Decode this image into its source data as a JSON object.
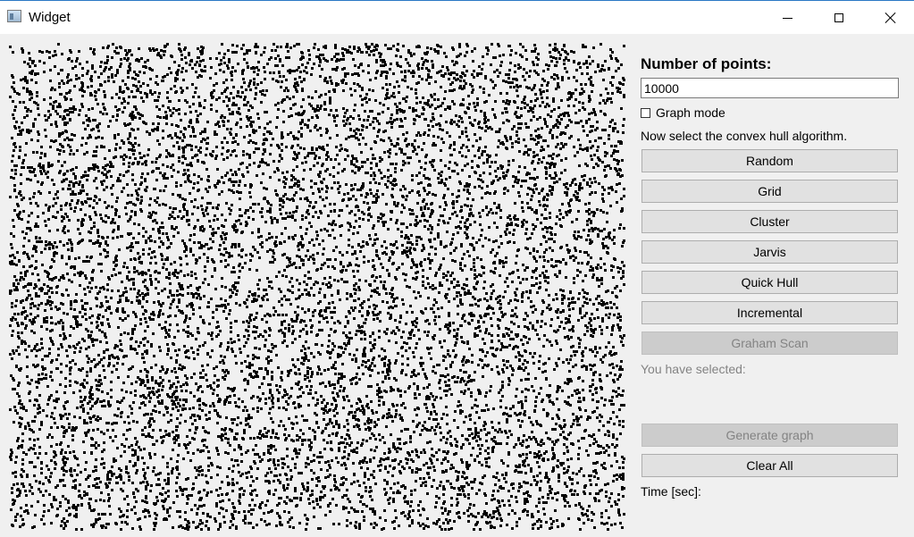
{
  "window": {
    "title": "Widget"
  },
  "canvas": {
    "point_count": 10000,
    "point_color": "#000000",
    "background": "#f0f0f0"
  },
  "panel": {
    "heading": "Number of points:",
    "points_value": "10000",
    "graph_mode_label": "Graph mode",
    "graph_mode_checked": false,
    "instruction": "Now select the convex hull algorithm.",
    "buttons": {
      "random": "Random",
      "grid": "Grid",
      "cluster": "Cluster",
      "jarvis": "Jarvis",
      "quick_hull": "Quick Hull",
      "incremental": "Incremental",
      "graham_scan": "Graham Scan"
    },
    "selected_label": "You have selected:",
    "generate_graph": "Generate graph",
    "clear_all": "Clear All",
    "time_label": "Time [sec]:"
  }
}
